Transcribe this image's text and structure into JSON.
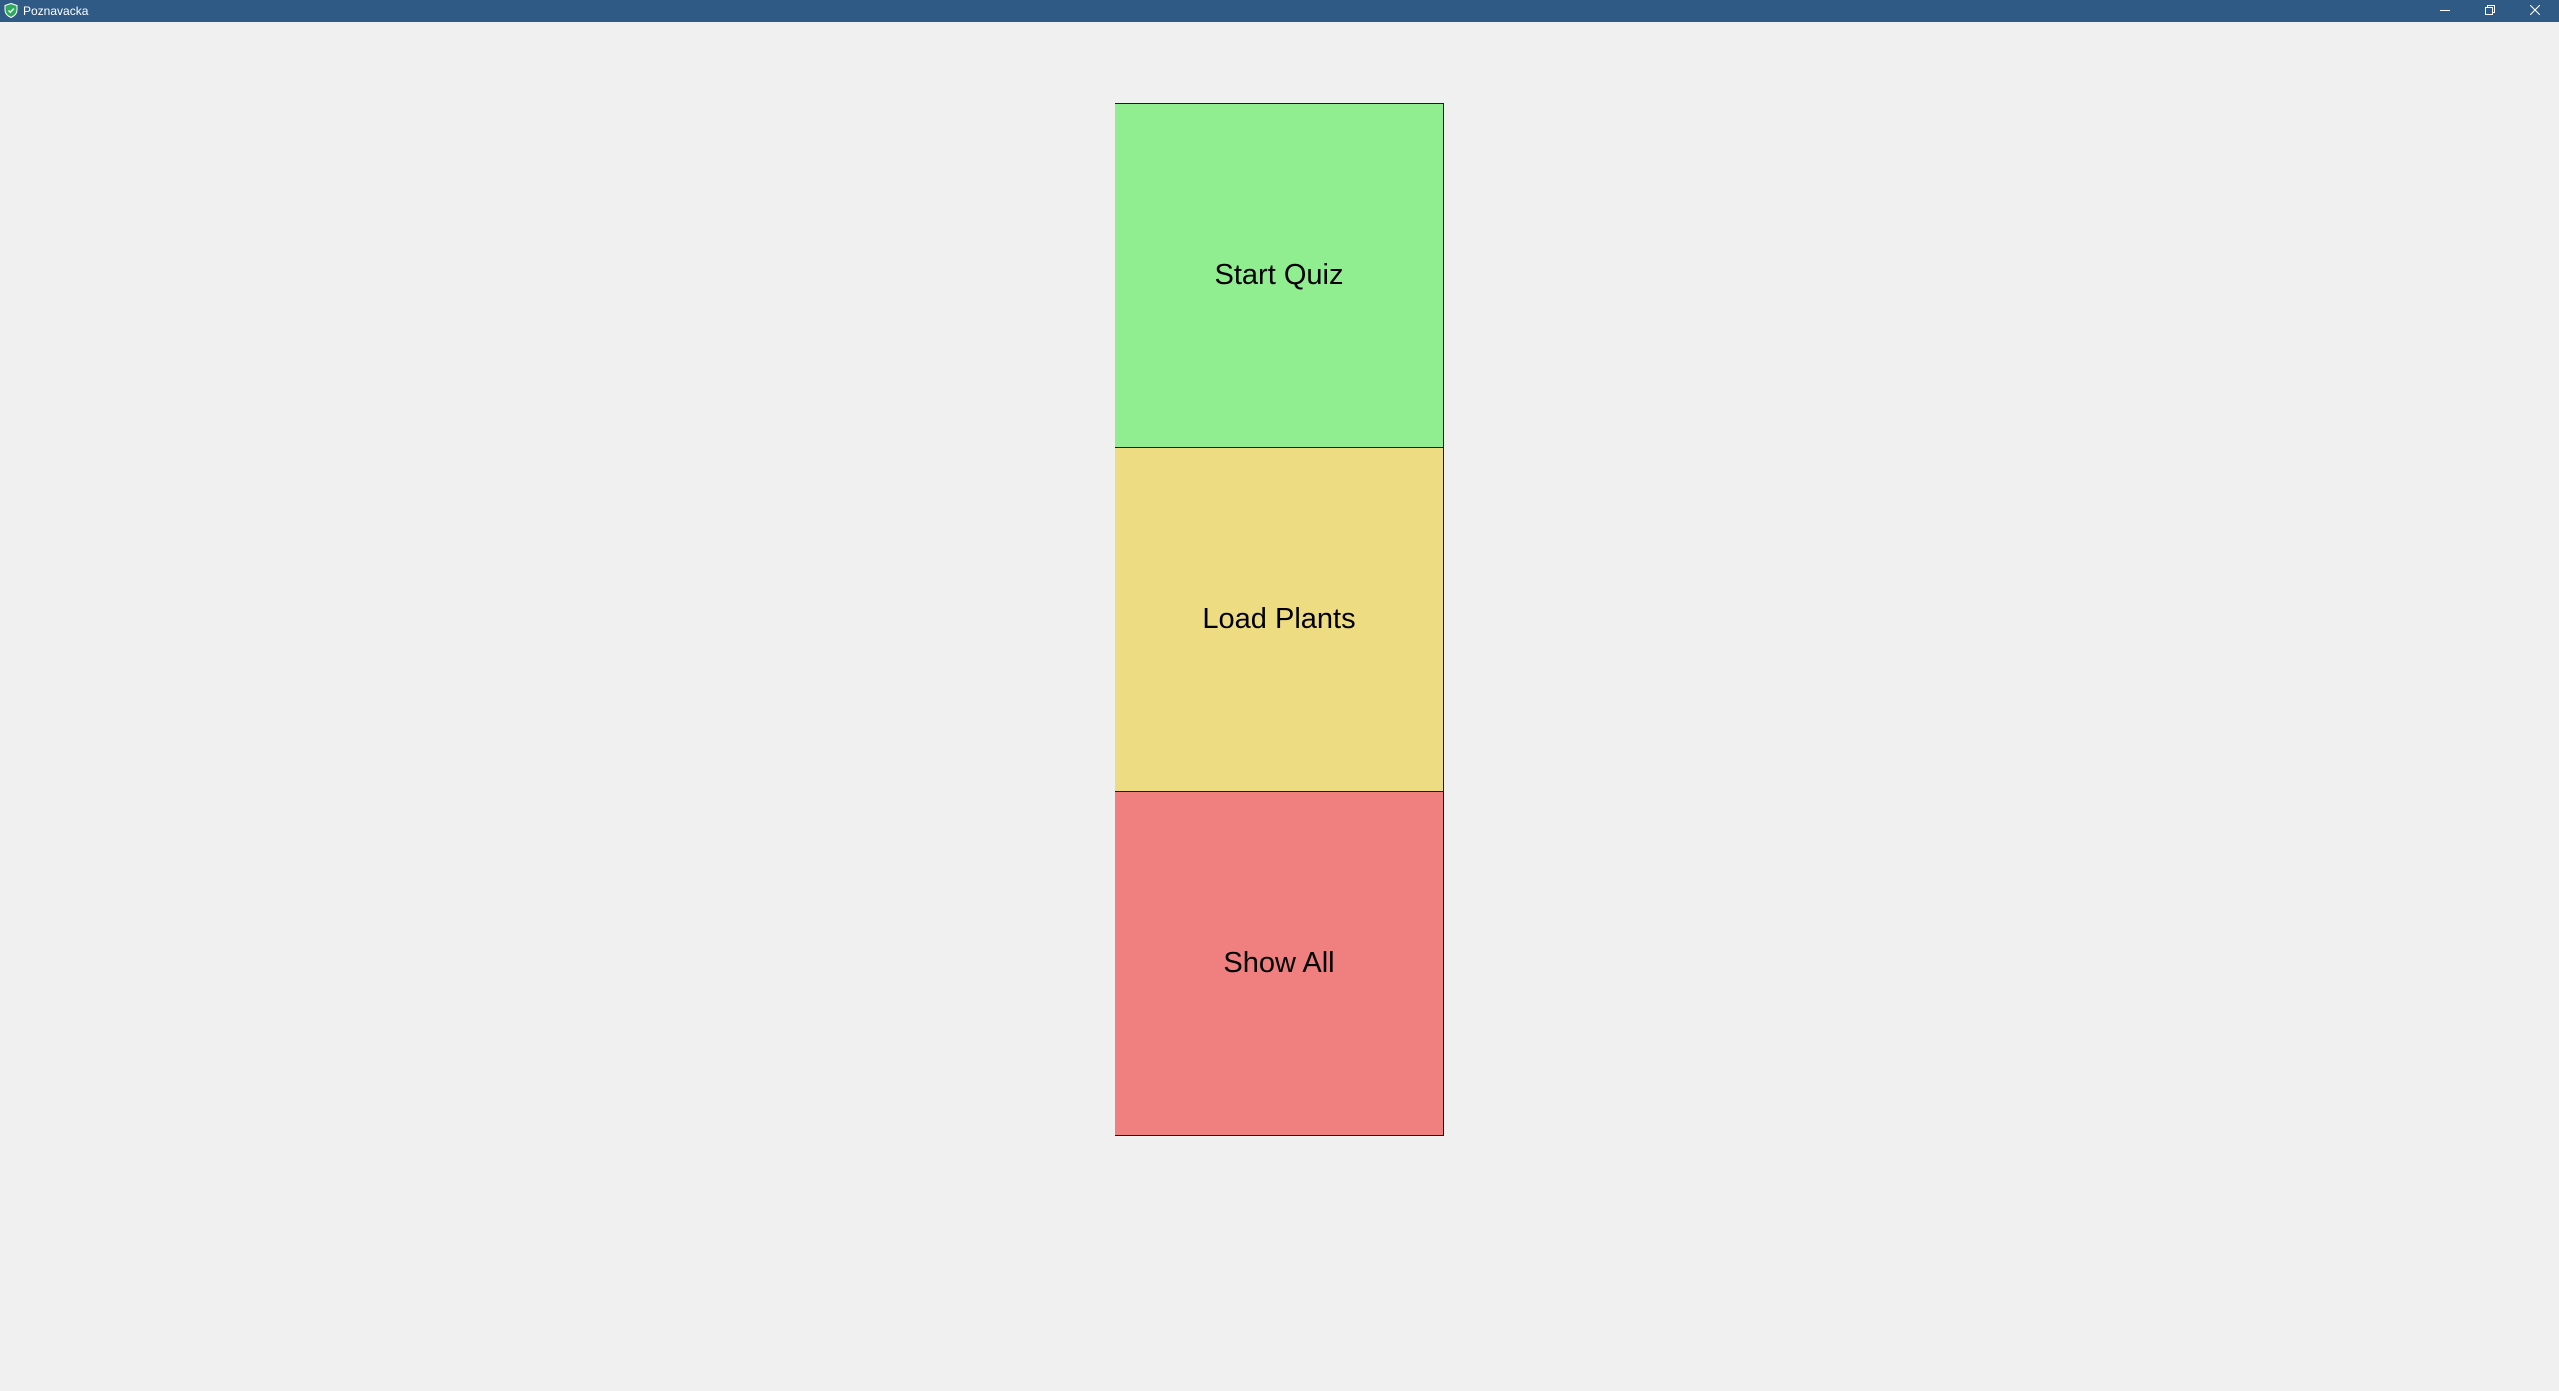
{
  "window": {
    "title": "Poznavacka",
    "titlebar_color": "#2f5a86",
    "app_icon": "shield-icon",
    "controls": {
      "minimize_icon": "minimize-icon",
      "maximize_icon": "restore-icon",
      "close_icon": "close-icon"
    }
  },
  "menu": {
    "start_quiz": {
      "label": "Start Quiz",
      "color": "#90ee90"
    },
    "load_plants": {
      "label": "Load Plants",
      "color": "#eedc82"
    },
    "show_all": {
      "label": "Show All",
      "color": "#f08080"
    }
  }
}
